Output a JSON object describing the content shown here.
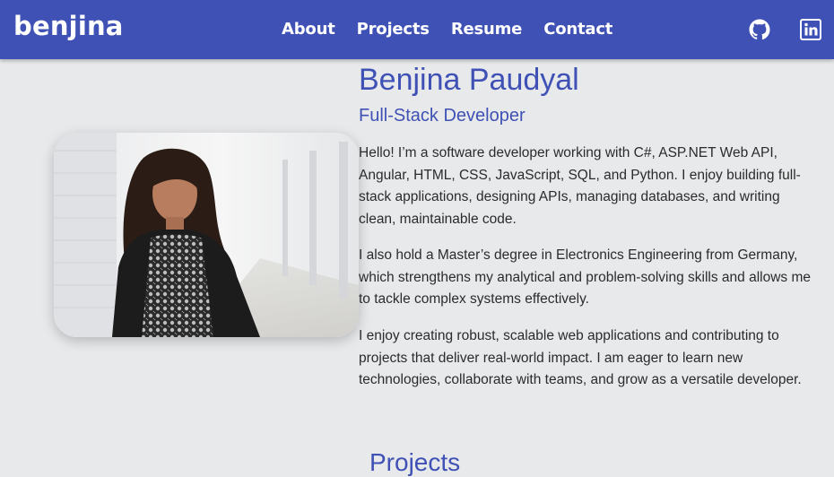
{
  "nav": {
    "brand": "benjina",
    "links": [
      "About",
      "Projects",
      "Resume",
      "Contact"
    ],
    "social": [
      "github-icon",
      "linkedin-icon"
    ]
  },
  "hero": {
    "name": "Benjina Paudyal",
    "role": "Full-Stack Developer",
    "paragraphs": [
      "Hello! I’m a software developer working with C#, ASP.NET Web API, Angular, HTML, CSS, JavaScript, SQL, and Python. I enjoy building full-stack applications, designing APIs, managing databases, and writing clean, maintainable code.",
      "I also hold a Master’s degree in Electronics Engineering from Germany, which strengthens my analytical and problem-solving skills and allows me to tackle complex systems effectively.",
      "I enjoy creating robust, scalable web applications and contributing to projects that deliver real-world impact. I am eager to learn new technologies, collaborate with teams, and grow as a versatile developer."
    ]
  },
  "projects": {
    "title": "Projects"
  },
  "colors": {
    "primary": "#3f51b5",
    "background": "#e8e9eb",
    "text": "#2b2b2b"
  }
}
